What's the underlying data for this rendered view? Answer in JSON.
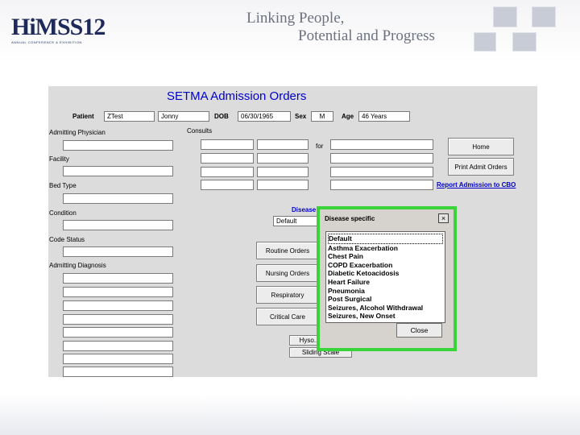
{
  "slide": {
    "logo": "HiMSS12",
    "logo_tagline": "ANNUAL CONFERENCE & EXHIBITION",
    "tagline_line1": "Linking People,",
    "tagline_line2": "Potential and Progress"
  },
  "form": {
    "title": "SETMA Admission Orders",
    "patient_label": "Patient",
    "patient_last": "ZTest",
    "patient_first": "Jonny",
    "dob_label": "DOB",
    "dob_value": "06/30/1965",
    "sex_label": "Sex",
    "sex_value": "M",
    "age_label": "Age",
    "age_value": "46 Years",
    "admitting_physician_label": "Admitting Physician",
    "consults_label": "Consults",
    "for_label": "for",
    "facility_label": "Facility",
    "bed_type_label": "Bed Type",
    "condition_label": "Condition",
    "code_status_label": "Code Status",
    "admitting_diagnosis_label": "Admitting Diagnosis",
    "disease_specific_label": "Disease Specific",
    "disease_specific_value": "Default",
    "home_button": "Home",
    "print_button": "Print Admit Orders",
    "report_link": "Report Admission to CBO",
    "routine_orders_button": "Routine Orders",
    "nursing_orders_button": "Nursing Orders",
    "respiratory_button": "Respiratory",
    "critical_care_button": "Critical Care",
    "hyso_button": "Hyso...",
    "sliding_scale_button": "Sliding Scale"
  },
  "dialog": {
    "title": "Disease specific",
    "close_glyph": "×",
    "items": [
      "Default",
      "Asthma Exacerbation",
      "Chest Pain",
      "COPD Exacerbation",
      "Diabetic Ketoacidosis",
      "Heart Failure",
      "Pneumonia",
      "Post Surgical",
      "Seizures, Alcohol Withdrawal",
      "Seizures, New Onset"
    ],
    "selected_index": 0,
    "close_button": "Close",
    "highlight_color": "#3ad43a"
  }
}
